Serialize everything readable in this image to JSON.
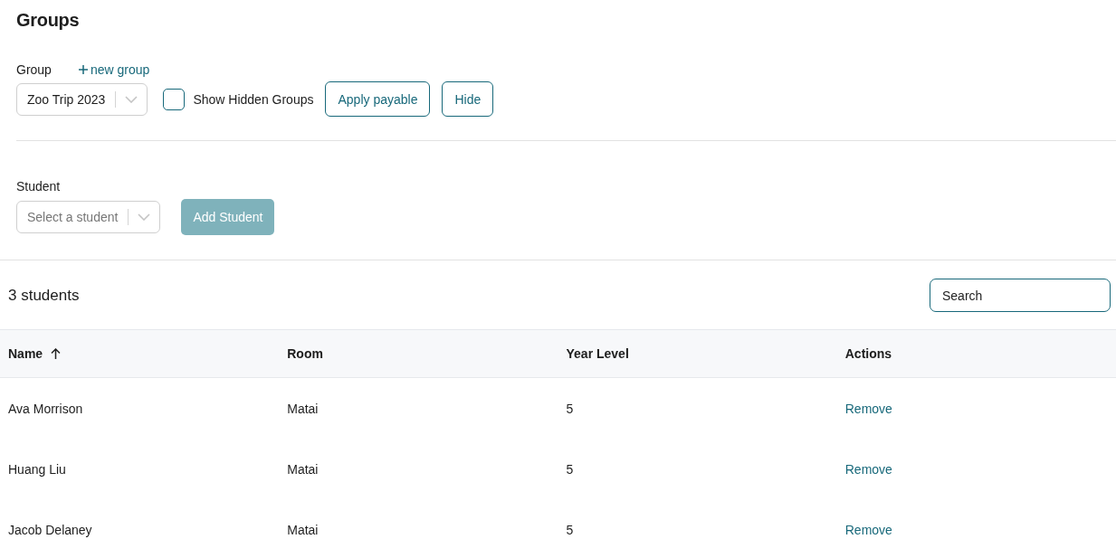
{
  "page": {
    "title": "Groups"
  },
  "group_section": {
    "label": "Group",
    "new_group_link": "new group",
    "select": {
      "value": "Zoo Trip 2023"
    },
    "show_hidden": {
      "label": "Show Hidden Groups",
      "checked": false
    },
    "buttons": [
      {
        "label": "Apply payable"
      },
      {
        "label": "Hide"
      }
    ]
  },
  "student_section": {
    "label": "Student",
    "select": {
      "placeholder": "Select a student"
    },
    "add_button": {
      "label": "Add Student",
      "disabled": true
    }
  },
  "table": {
    "count": "3 students",
    "search": {
      "placeholder": "Search"
    },
    "columns": [
      {
        "label": "Name",
        "sorted": true
      },
      {
        "label": "Room",
        "sorted": false
      },
      {
        "label": "Year Level",
        "sorted": false
      },
      {
        "label": "Actions",
        "sorted": false
      }
    ],
    "rows": [
      {
        "name": "Ava Morrison",
        "room": "Matai",
        "year_level": "5",
        "action": "Remove"
      },
      {
        "name": "Huang Liu",
        "room": "Matai",
        "year_level": "5",
        "action": "Remove"
      },
      {
        "name": "Jacob Delaney",
        "room": "Matai",
        "year_level": "5",
        "action": "Remove"
      }
    ]
  }
}
